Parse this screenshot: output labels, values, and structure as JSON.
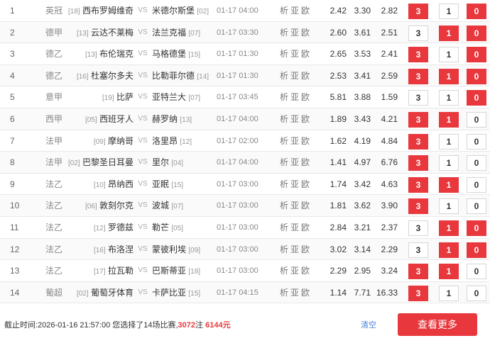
{
  "vs_label": "VS",
  "link_labels": [
    "析",
    "亚",
    "欧"
  ],
  "matches": [
    {
      "idx": "1",
      "league": "英冠",
      "home_rank": "[18]",
      "home": "西布罗姆维奇",
      "away": "米德尔斯堡",
      "away_rank": "[02]",
      "time": "01-17 04:00",
      "odds": [
        "2.42",
        "3.30",
        "2.82"
      ],
      "picks": [
        {
          "label": "3",
          "selected": true
        },
        {
          "label": "1",
          "selected": false
        },
        {
          "label": "0",
          "selected": true
        }
      ]
    },
    {
      "idx": "2",
      "league": "德甲",
      "home_rank": "[13]",
      "home": "云达不莱梅",
      "away": "法兰克福",
      "away_rank": "[07]",
      "time": "01-17 03:30",
      "odds": [
        "2.60",
        "3.61",
        "2.51"
      ],
      "picks": [
        {
          "label": "3",
          "selected": false
        },
        {
          "label": "1",
          "selected": true
        },
        {
          "label": "0",
          "selected": true
        }
      ]
    },
    {
      "idx": "3",
      "league": "德乙",
      "home_rank": "[13]",
      "home": "布伦瑞克",
      "away": "马格德堡",
      "away_rank": "[15]",
      "time": "01-17 01:30",
      "odds": [
        "2.65",
        "3.53",
        "2.41"
      ],
      "picks": [
        {
          "label": "3",
          "selected": true
        },
        {
          "label": "1",
          "selected": false
        },
        {
          "label": "0",
          "selected": true
        }
      ]
    },
    {
      "idx": "4",
      "league": "德乙",
      "home_rank": "[16]",
      "home": "杜塞尔多夫",
      "away": "比勒菲尔德",
      "away_rank": "[14]",
      "time": "01-17 01:30",
      "odds": [
        "2.53",
        "3.41",
        "2.59"
      ],
      "picks": [
        {
          "label": "3",
          "selected": true
        },
        {
          "label": "1",
          "selected": true
        },
        {
          "label": "0",
          "selected": true
        }
      ]
    },
    {
      "idx": "5",
      "league": "意甲",
      "home_rank": "[19]",
      "home": "比萨",
      "away": "亚特兰大",
      "away_rank": "[07]",
      "time": "01-17 03:45",
      "odds": [
        "5.81",
        "3.88",
        "1.59"
      ],
      "picks": [
        {
          "label": "3",
          "selected": false
        },
        {
          "label": "1",
          "selected": false
        },
        {
          "label": "0",
          "selected": true
        }
      ]
    },
    {
      "idx": "6",
      "league": "西甲",
      "home_rank": "[05]",
      "home": "西班牙人",
      "away": "赫罗纳",
      "away_rank": "[13]",
      "time": "01-17 04:00",
      "odds": [
        "1.89",
        "3.43",
        "4.21"
      ],
      "picks": [
        {
          "label": "3",
          "selected": true
        },
        {
          "label": "1",
          "selected": true
        },
        {
          "label": "0",
          "selected": false
        }
      ]
    },
    {
      "idx": "7",
      "league": "法甲",
      "home_rank": "[09]",
      "home": "摩纳哥",
      "away": "洛里昂",
      "away_rank": "[12]",
      "time": "01-17 02:00",
      "odds": [
        "1.62",
        "4.19",
        "4.84"
      ],
      "picks": [
        {
          "label": "3",
          "selected": true
        },
        {
          "label": "1",
          "selected": false
        },
        {
          "label": "0",
          "selected": false
        }
      ]
    },
    {
      "idx": "8",
      "league": "法甲",
      "home_rank": "[02]",
      "home": "巴黎圣日耳曼",
      "away": "里尔",
      "away_rank": "[04]",
      "time": "01-17 04:00",
      "odds": [
        "1.41",
        "4.97",
        "6.76"
      ],
      "picks": [
        {
          "label": "3",
          "selected": true
        },
        {
          "label": "1",
          "selected": false
        },
        {
          "label": "0",
          "selected": false
        }
      ]
    },
    {
      "idx": "9",
      "league": "法乙",
      "home_rank": "[10]",
      "home": "昂纳西",
      "away": "亚眠",
      "away_rank": "[15]",
      "time": "01-17 03:00",
      "odds": [
        "1.74",
        "3.42",
        "4.63"
      ],
      "picks": [
        {
          "label": "3",
          "selected": true
        },
        {
          "label": "1",
          "selected": true
        },
        {
          "label": "0",
          "selected": false
        }
      ]
    },
    {
      "idx": "10",
      "league": "法乙",
      "home_rank": "[06]",
      "home": "敦刻尔克",
      "away": "波城",
      "away_rank": "[07]",
      "time": "01-17 03:00",
      "odds": [
        "1.81",
        "3.62",
        "3.90"
      ],
      "picks": [
        {
          "label": "3",
          "selected": true
        },
        {
          "label": "1",
          "selected": false
        },
        {
          "label": "0",
          "selected": false
        }
      ]
    },
    {
      "idx": "11",
      "league": "法乙",
      "home_rank": "[12]",
      "home": "罗德兹",
      "away": "勒芒",
      "away_rank": "[05]",
      "time": "01-17 03:00",
      "odds": [
        "2.84",
        "3.21",
        "2.37"
      ],
      "picks": [
        {
          "label": "3",
          "selected": false
        },
        {
          "label": "1",
          "selected": true
        },
        {
          "label": "0",
          "selected": true
        }
      ]
    },
    {
      "idx": "12",
      "league": "法乙",
      "home_rank": "[16]",
      "home": "布洛涅",
      "away": "蒙彼利埃",
      "away_rank": "[09]",
      "time": "01-17 03:00",
      "odds": [
        "3.02",
        "3.14",
        "2.29"
      ],
      "picks": [
        {
          "label": "3",
          "selected": false
        },
        {
          "label": "1",
          "selected": true
        },
        {
          "label": "0",
          "selected": true
        }
      ]
    },
    {
      "idx": "13",
      "league": "法乙",
      "home_rank": "[17]",
      "home": "拉瓦勒",
      "away": "巴斯蒂亚",
      "away_rank": "[18]",
      "time": "01-17 03:00",
      "odds": [
        "2.29",
        "2.95",
        "3.24"
      ],
      "picks": [
        {
          "label": "3",
          "selected": true
        },
        {
          "label": "1",
          "selected": true
        },
        {
          "label": "0",
          "selected": false
        }
      ]
    },
    {
      "idx": "14",
      "league": "葡超",
      "home_rank": "[02]",
      "home": "葡萄牙体育",
      "away": "卡萨比亚",
      "away_rank": "[15]",
      "time": "01-17 04:15",
      "odds": [
        "1.14",
        "7.71",
        "16.33"
      ],
      "picks": [
        {
          "label": "3",
          "selected": true
        },
        {
          "label": "1",
          "selected": false
        },
        {
          "label": "0",
          "selected": false
        }
      ]
    }
  ],
  "footer": {
    "deadline_prefix": "截止时间:2026-01-16 21:57:00 您选择了14场比赛,",
    "bets": "3072",
    "bets_unit": "注 ",
    "amount": "6144元",
    "clear_label": "清空",
    "more_label": "查看更多"
  },
  "colors": {
    "accent": "#e8383d",
    "link": "#4a7fd6"
  }
}
